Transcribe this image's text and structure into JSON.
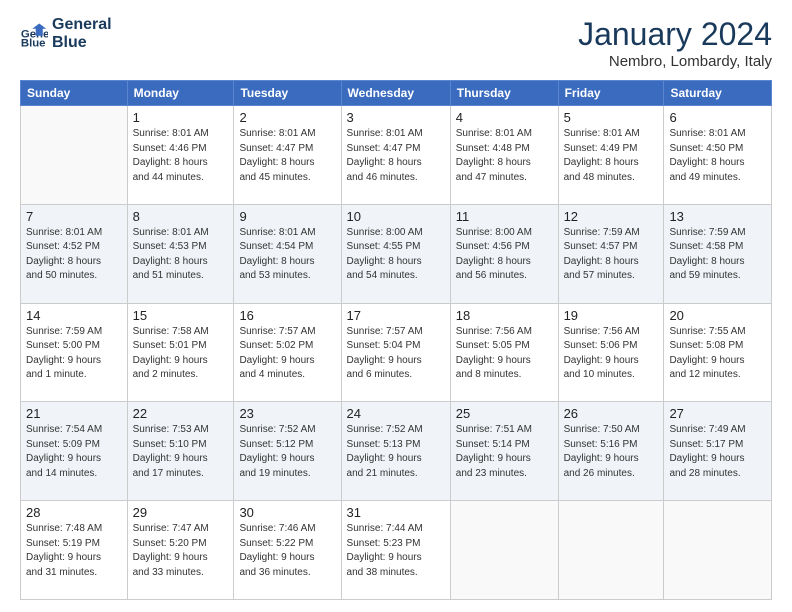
{
  "logo": {
    "line1": "General",
    "line2": "Blue"
  },
  "title": "January 2024",
  "subtitle": "Nembro, Lombardy, Italy",
  "header_days": [
    "Sunday",
    "Monday",
    "Tuesday",
    "Wednesday",
    "Thursday",
    "Friday",
    "Saturday"
  ],
  "weeks": [
    [
      {
        "day": "",
        "info": ""
      },
      {
        "day": "1",
        "info": "Sunrise: 8:01 AM\nSunset: 4:46 PM\nDaylight: 8 hours\nand 44 minutes."
      },
      {
        "day": "2",
        "info": "Sunrise: 8:01 AM\nSunset: 4:47 PM\nDaylight: 8 hours\nand 45 minutes."
      },
      {
        "day": "3",
        "info": "Sunrise: 8:01 AM\nSunset: 4:47 PM\nDaylight: 8 hours\nand 46 minutes."
      },
      {
        "day": "4",
        "info": "Sunrise: 8:01 AM\nSunset: 4:48 PM\nDaylight: 8 hours\nand 47 minutes."
      },
      {
        "day": "5",
        "info": "Sunrise: 8:01 AM\nSunset: 4:49 PM\nDaylight: 8 hours\nand 48 minutes."
      },
      {
        "day": "6",
        "info": "Sunrise: 8:01 AM\nSunset: 4:50 PM\nDaylight: 8 hours\nand 49 minutes."
      }
    ],
    [
      {
        "day": "7",
        "info": "Sunrise: 8:01 AM\nSunset: 4:52 PM\nDaylight: 8 hours\nand 50 minutes."
      },
      {
        "day": "8",
        "info": "Sunrise: 8:01 AM\nSunset: 4:53 PM\nDaylight: 8 hours\nand 51 minutes."
      },
      {
        "day": "9",
        "info": "Sunrise: 8:01 AM\nSunset: 4:54 PM\nDaylight: 8 hours\nand 53 minutes."
      },
      {
        "day": "10",
        "info": "Sunrise: 8:00 AM\nSunset: 4:55 PM\nDaylight: 8 hours\nand 54 minutes."
      },
      {
        "day": "11",
        "info": "Sunrise: 8:00 AM\nSunset: 4:56 PM\nDaylight: 8 hours\nand 56 minutes."
      },
      {
        "day": "12",
        "info": "Sunrise: 7:59 AM\nSunset: 4:57 PM\nDaylight: 8 hours\nand 57 minutes."
      },
      {
        "day": "13",
        "info": "Sunrise: 7:59 AM\nSunset: 4:58 PM\nDaylight: 8 hours\nand 59 minutes."
      }
    ],
    [
      {
        "day": "14",
        "info": "Sunrise: 7:59 AM\nSunset: 5:00 PM\nDaylight: 9 hours\nand 1 minute."
      },
      {
        "day": "15",
        "info": "Sunrise: 7:58 AM\nSunset: 5:01 PM\nDaylight: 9 hours\nand 2 minutes."
      },
      {
        "day": "16",
        "info": "Sunrise: 7:57 AM\nSunset: 5:02 PM\nDaylight: 9 hours\nand 4 minutes."
      },
      {
        "day": "17",
        "info": "Sunrise: 7:57 AM\nSunset: 5:04 PM\nDaylight: 9 hours\nand 6 minutes."
      },
      {
        "day": "18",
        "info": "Sunrise: 7:56 AM\nSunset: 5:05 PM\nDaylight: 9 hours\nand 8 minutes."
      },
      {
        "day": "19",
        "info": "Sunrise: 7:56 AM\nSunset: 5:06 PM\nDaylight: 9 hours\nand 10 minutes."
      },
      {
        "day": "20",
        "info": "Sunrise: 7:55 AM\nSunset: 5:08 PM\nDaylight: 9 hours\nand 12 minutes."
      }
    ],
    [
      {
        "day": "21",
        "info": "Sunrise: 7:54 AM\nSunset: 5:09 PM\nDaylight: 9 hours\nand 14 minutes."
      },
      {
        "day": "22",
        "info": "Sunrise: 7:53 AM\nSunset: 5:10 PM\nDaylight: 9 hours\nand 17 minutes."
      },
      {
        "day": "23",
        "info": "Sunrise: 7:52 AM\nSunset: 5:12 PM\nDaylight: 9 hours\nand 19 minutes."
      },
      {
        "day": "24",
        "info": "Sunrise: 7:52 AM\nSunset: 5:13 PM\nDaylight: 9 hours\nand 21 minutes."
      },
      {
        "day": "25",
        "info": "Sunrise: 7:51 AM\nSunset: 5:14 PM\nDaylight: 9 hours\nand 23 minutes."
      },
      {
        "day": "26",
        "info": "Sunrise: 7:50 AM\nSunset: 5:16 PM\nDaylight: 9 hours\nand 26 minutes."
      },
      {
        "day": "27",
        "info": "Sunrise: 7:49 AM\nSunset: 5:17 PM\nDaylight: 9 hours\nand 28 minutes."
      }
    ],
    [
      {
        "day": "28",
        "info": "Sunrise: 7:48 AM\nSunset: 5:19 PM\nDaylight: 9 hours\nand 31 minutes."
      },
      {
        "day": "29",
        "info": "Sunrise: 7:47 AM\nSunset: 5:20 PM\nDaylight: 9 hours\nand 33 minutes."
      },
      {
        "day": "30",
        "info": "Sunrise: 7:46 AM\nSunset: 5:22 PM\nDaylight: 9 hours\nand 36 minutes."
      },
      {
        "day": "31",
        "info": "Sunrise: 7:44 AM\nSunset: 5:23 PM\nDaylight: 9 hours\nand 38 minutes."
      },
      {
        "day": "",
        "info": ""
      },
      {
        "day": "",
        "info": ""
      },
      {
        "day": "",
        "info": ""
      }
    ]
  ]
}
